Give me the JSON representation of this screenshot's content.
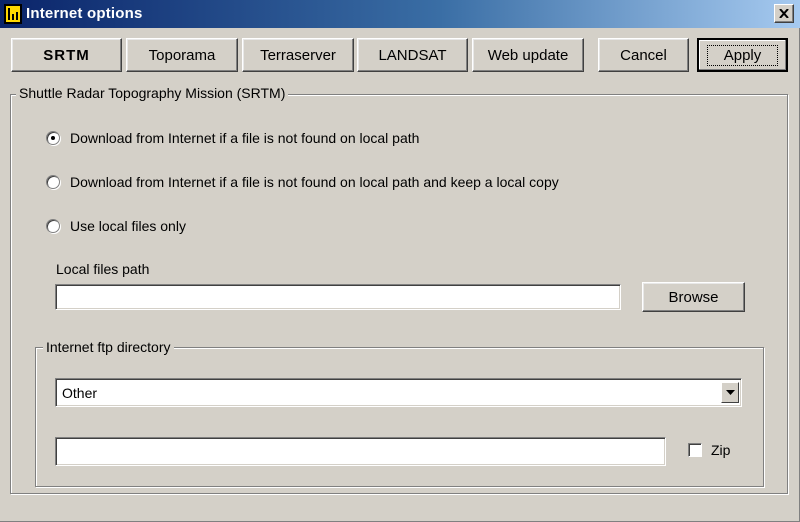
{
  "window": {
    "title": "Internet options"
  },
  "tabs": [
    "SRTM",
    "Toporama",
    "Terraserver",
    "LANDSAT",
    "Web update"
  ],
  "buttons": {
    "cancel": "Cancel",
    "apply": "Apply",
    "browse": "Browse"
  },
  "srtm_group": {
    "label": "Shuttle Radar Topography Mission (SRTM)",
    "options": [
      "Download from Internet if a file is not found on local path",
      "Download from Internet if a file is not found on local path and keep a local copy",
      "Use local files only"
    ],
    "selected_index": 0,
    "local_path_label": "Local files path",
    "local_path_value": ""
  },
  "ftp_group": {
    "label": "Internet ftp directory",
    "selected": "Other",
    "ftp_value": "",
    "zip_label": "Zip",
    "zip_checked": false
  },
  "colors": {
    "title_bar_start": "#0a246a",
    "title_bar_end": "#a6caf0",
    "face": "#d4d0c8"
  }
}
